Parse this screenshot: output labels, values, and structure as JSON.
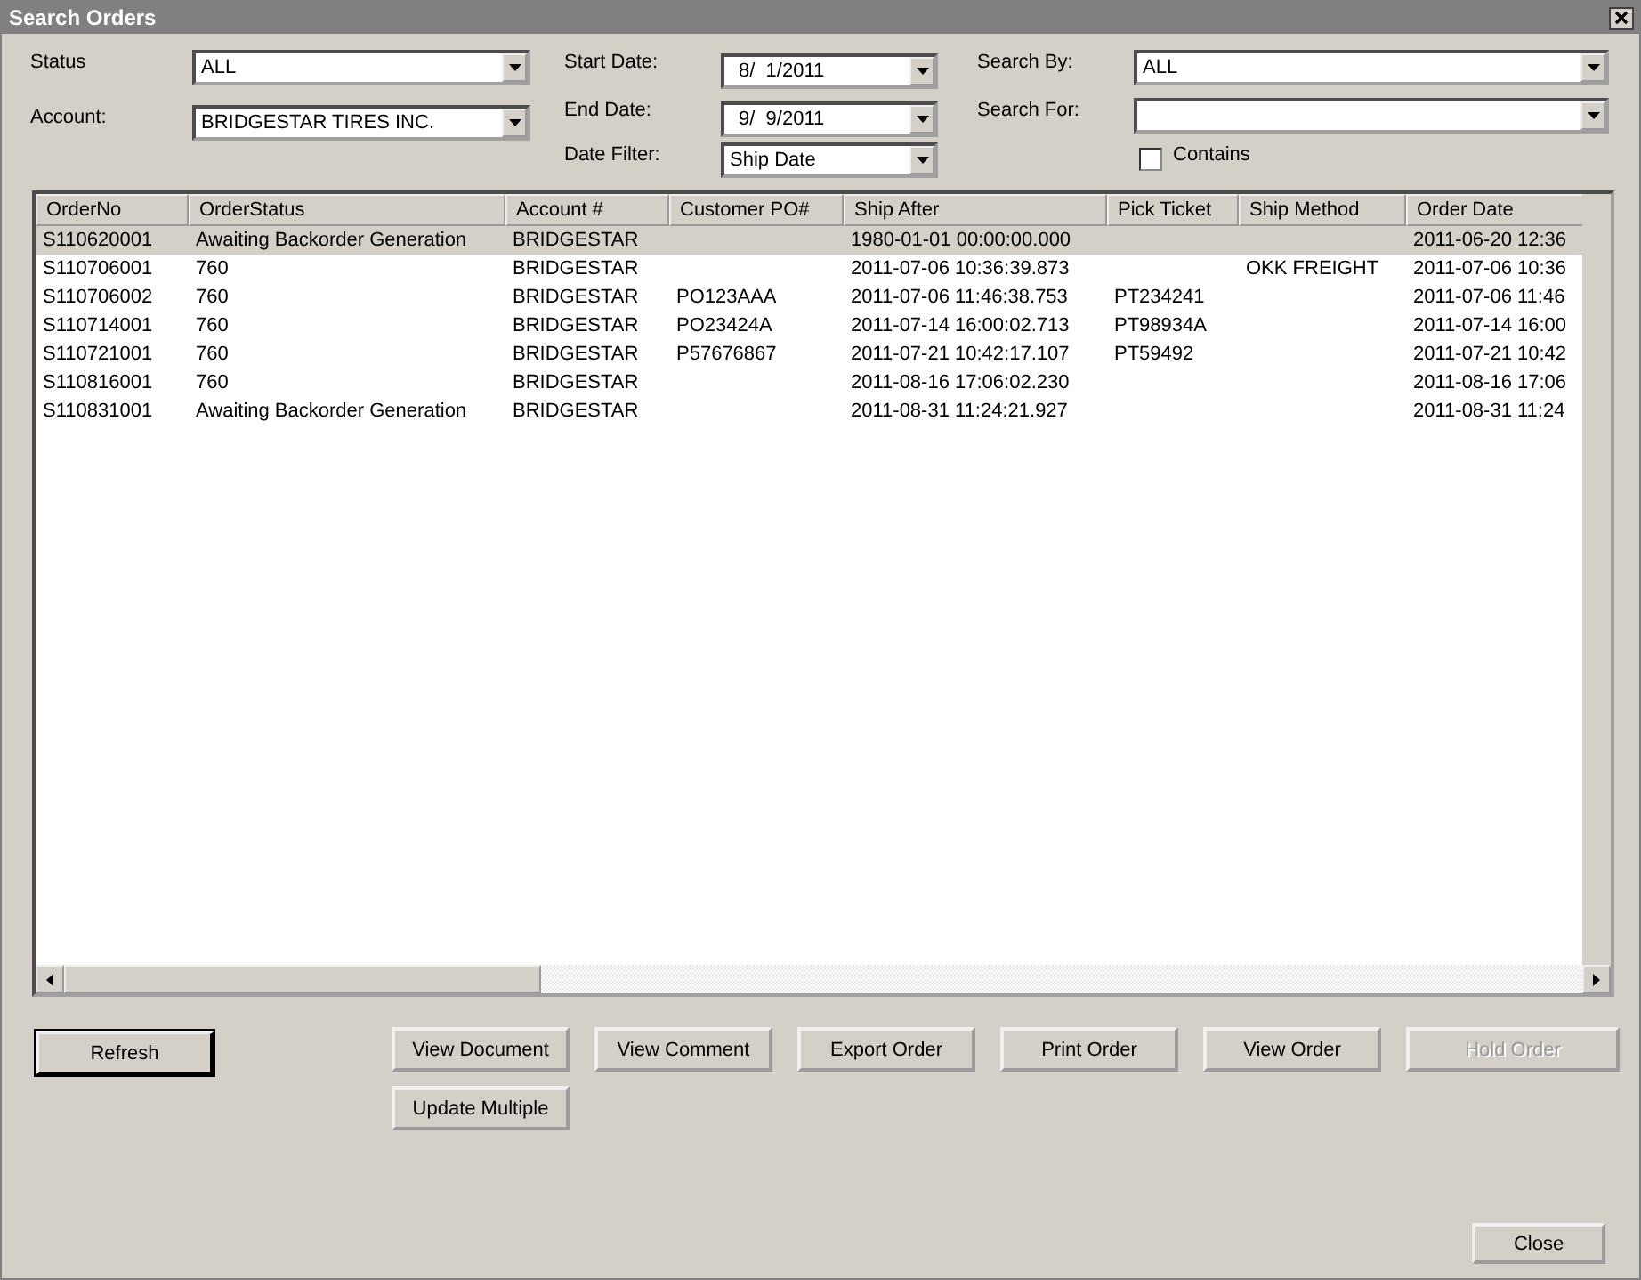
{
  "window": {
    "title": "Search Orders"
  },
  "filter_columns": [
    {
      "fields": [
        {
          "kind": "dropdown",
          "label": "Status",
          "value": "ALL"
        },
        {
          "kind": "dropdown",
          "label": "Account:",
          "value": "BRIDGESTAR TIRES INC."
        }
      ]
    },
    {
      "fields": [
        {
          "kind": "date",
          "label": "Start Date:",
          "value": "8/  1/2011"
        },
        {
          "kind": "date",
          "label": "End Date:",
          "value": "9/  9/2011"
        },
        {
          "kind": "dropdown",
          "label": "Date Filter:",
          "value": "Ship Date"
        }
      ]
    },
    {
      "fields": [
        {
          "kind": "dropdown",
          "label": "Search By:",
          "value": "ALL"
        },
        {
          "kind": "dropdown",
          "label": "Search For:"
        },
        {
          "kind": "checkbox",
          "label": "Contains",
          "checked": false
        }
      ]
    }
  ],
  "table": {
    "columns": [
      "OrderNo",
      "OrderStatus",
      "Account #",
      "Customer PO#",
      "Ship After",
      "Pick Ticket",
      "Ship Method",
      "Order Date"
    ],
    "rows": [
      {
        "selected": true,
        "cells": [
          "S110620001",
          "Awaiting Backorder Generation",
          "BRIDGESTAR",
          "",
          "1980-01-01 00:00:00.000",
          "",
          "",
          "2011-06-20 12:36"
        ]
      },
      {
        "selected": false,
        "cells": [
          "S110706001",
          "760",
          "BRIDGESTAR",
          "",
          "2011-07-06 10:36:39.873",
          "",
          "OKK FREIGHT",
          "2011-07-06 10:36"
        ]
      },
      {
        "selected": false,
        "cells": [
          "S110706002",
          "760",
          "BRIDGESTAR",
          "PO123AAA",
          "2011-07-06 11:46:38.753",
          "PT234241",
          "",
          "2011-07-06 11:46"
        ]
      },
      {
        "selected": false,
        "cells": [
          "S110714001",
          "760",
          "BRIDGESTAR",
          "PO23424A",
          "2011-07-14 16:00:02.713",
          "PT98934A",
          "",
          "2011-07-14 16:00"
        ]
      },
      {
        "selected": false,
        "cells": [
          "S110721001",
          "760",
          "BRIDGESTAR",
          "P57676867",
          "2011-07-21 10:42:17.107",
          "PT59492",
          "",
          "2011-07-21 10:42"
        ]
      },
      {
        "selected": false,
        "cells": [
          "S110816001",
          "760",
          "BRIDGESTAR",
          "",
          "2011-08-16 17:06:02.230",
          "",
          "",
          "2011-08-16 17:06"
        ]
      },
      {
        "selected": false,
        "cells": [
          "S110831001",
          "Awaiting Backorder Generation",
          "BRIDGESTAR",
          "",
          "2011-08-31 11:24:21.927",
          "",
          "",
          "2011-08-31 11:24"
        ]
      }
    ]
  },
  "refresh_button": {
    "label": "Refresh",
    "default": true
  },
  "action_buttons": [
    {
      "label": "View Document",
      "disabled": false
    },
    {
      "label": "View Comment",
      "disabled": false
    },
    {
      "label": "Export Order",
      "disabled": false
    },
    {
      "label": "Print Order",
      "disabled": false
    },
    {
      "label": "View Order",
      "disabled": false
    },
    {
      "label": "Hold Order",
      "disabled": true
    },
    {
      "label": "Update Multiple",
      "disabled": false
    }
  ],
  "close_button": {
    "label": "Close"
  }
}
